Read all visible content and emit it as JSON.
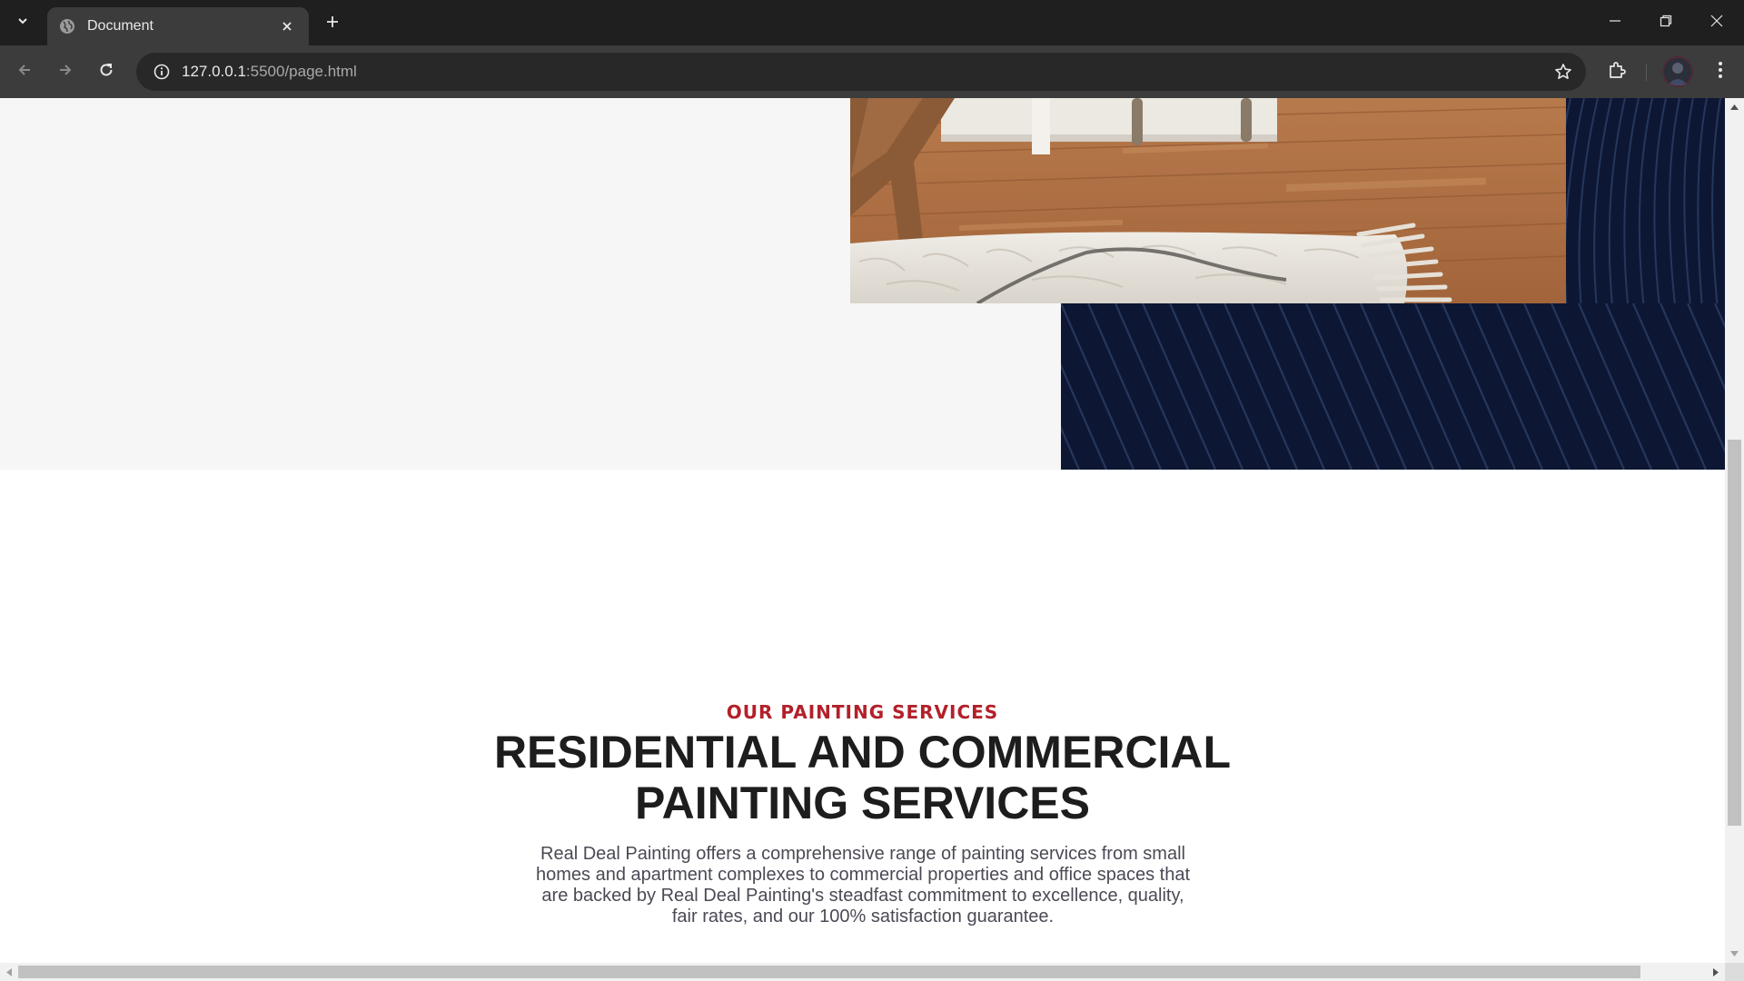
{
  "browser": {
    "tab_title": "Document",
    "url_host": "127.0.0.1",
    "url_rest": ":5500/page.html",
    "icons": {
      "tab_search": "chevron-down-icon",
      "favicon": "globe-icon",
      "tab_close": "close-icon",
      "new_tab": "plus-icon",
      "back": "arrow-left-icon",
      "forward": "arrow-right-icon",
      "reload": "reload-icon",
      "site_info": "info-icon",
      "bookmark": "star-icon",
      "extensions": "puzzle-icon",
      "menu": "kebab-icon"
    }
  },
  "services": {
    "eyebrow": "OUR PAINTING SERVICES",
    "headline_line1": "RESIDENTIAL AND COMMERCIAL",
    "headline_line2": "PAINTING SERVICES",
    "description": "Real Deal Painting offers a comprehensive range of painting services from small homes and apartment complexes to commercial properties and office spaces that are backed by Real Deal Painting's steadfast commitment to excellence, quality, fair rates, and our 100% satisfaction guarantee."
  },
  "colors": {
    "accent_red": "#b3202a",
    "navy": "#0d1733",
    "heading": "#1d1d1d",
    "body_text": "#4a4a55",
    "hero_bg": "#f6f6f6"
  },
  "scroll": {
    "vertical_position": 0.73,
    "horizontal_position": 0.0
  }
}
